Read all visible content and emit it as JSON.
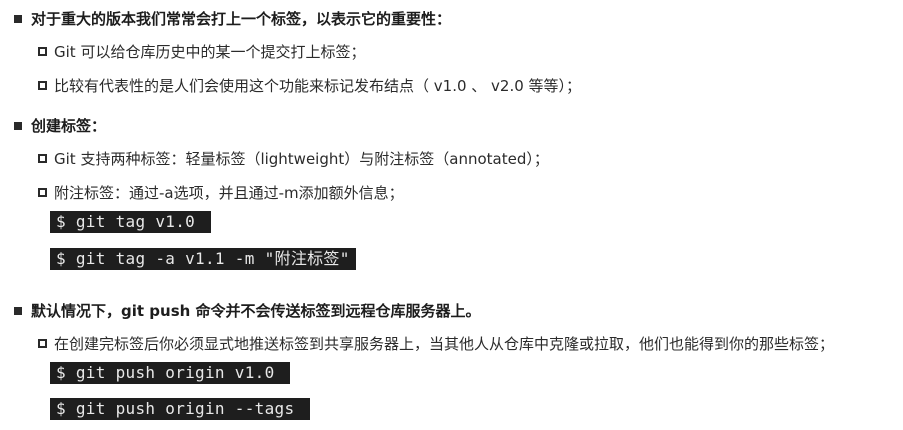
{
  "sections": [
    {
      "heading": "对于重大的版本我们常常会打上一个标签，以表示它的重要性：",
      "items": [
        "Git 可以给仓库历史中的某一个提交打上标签；",
        "比较有代表性的是人们会使用这个功能来标记发布结点（ v1.0 、 v2.0 等等）；"
      ]
    },
    {
      "heading": "创建标签：",
      "items": [
        "Git 支持两种标签：轻量标签（lightweight）与附注标签（annotated）；",
        "附注标签：通过-a选项，并且通过-m添加额外信息；"
      ],
      "code": [
        "$ git tag v1.0 ",
        "$ git tag -a v1.1 -m \"附注标签\""
      ]
    },
    {
      "heading": "默认情况下，git push 命令并不会传送标签到远程仓库服务器上。",
      "items": [
        "在创建完标签后你必须显式地推送标签到共享服务器上，当其他人从仓库中克隆或拉取，他们也能得到你的那些标签；"
      ],
      "code": [
        "$ git push origin v1.0 ",
        "$ git push origin --tags "
      ]
    }
  ]
}
